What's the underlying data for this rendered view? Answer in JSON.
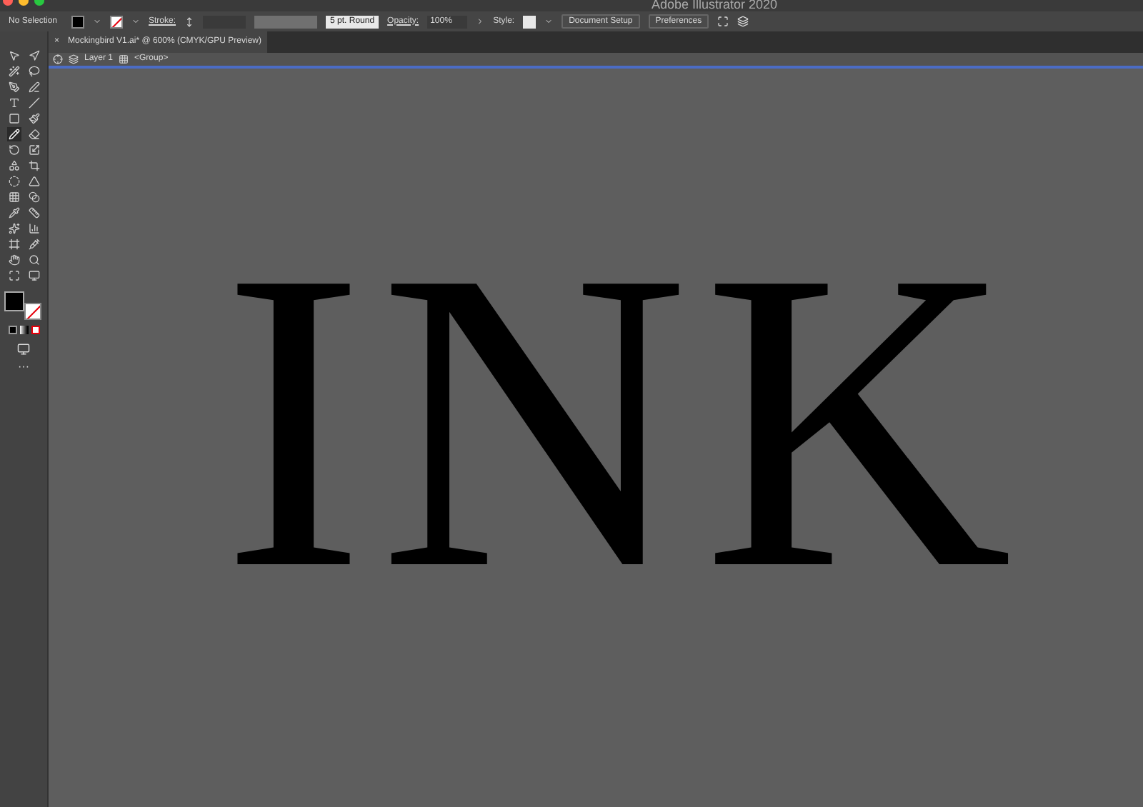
{
  "window": {
    "title": "Adobe Illustrator 2020"
  },
  "control_bar": {
    "selection": "No Selection",
    "stroke_label": "Stroke:",
    "brush": "5 pt. Round",
    "opacity_label": "Opacity:",
    "opacity": "100%",
    "style_label": "Style:",
    "buttons": [
      "Document Setup",
      "Preferences"
    ]
  },
  "document_tab": {
    "close": "×",
    "title": "Mockingbird V1.ai* @ 600% (CMYK/GPU Preview)"
  },
  "breadcrumb": {
    "layer": "Layer 1",
    "group": "<Group>"
  },
  "toolbar": {
    "tools": [
      {
        "selected": false
      },
      {
        "selected": false
      },
      {
        "selected": false
      },
      {
        "selected": false
      },
      {
        "selected": false
      },
      {
        "selected": false
      },
      {
        "selected": false
      },
      {
        "selected": false
      },
      {
        "selected": false
      },
      {
        "selected": false
      },
      {
        "selected": true
      },
      {
        "selected": false
      },
      {
        "selected": false
      },
      {
        "selected": false
      },
      {
        "selected": false
      },
      {
        "selected": false
      },
      {
        "selected": false
      },
      {
        "selected": false
      },
      {
        "selected": false
      },
      {
        "selected": false
      },
      {
        "selected": false
      },
      {
        "selected": false
      },
      {
        "selected": false
      },
      {
        "selected": false
      },
      {
        "selected": false
      },
      {
        "selected": false
      },
      {
        "selected": false
      },
      {
        "selected": false
      },
      {
        "selected": false
      },
      {
        "selected": false
      }
    ],
    "more": "···"
  },
  "artwork": {
    "text": "INK"
  }
}
